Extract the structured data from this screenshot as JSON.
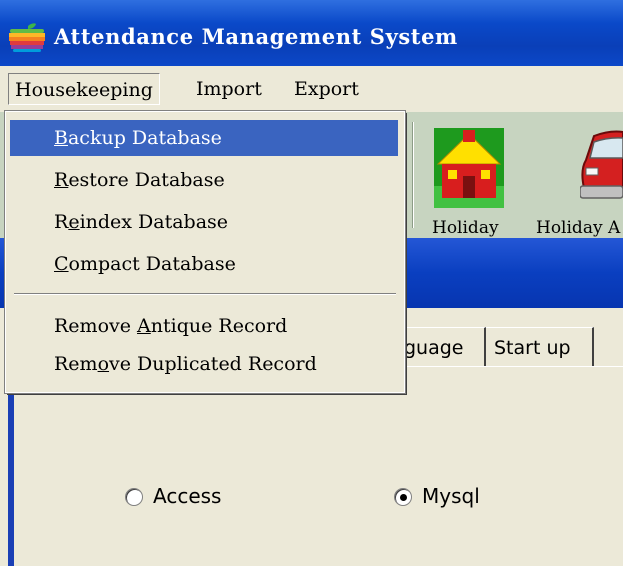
{
  "window": {
    "title": "Attendance Management System",
    "icon": "apple-logo-icon"
  },
  "menubar": {
    "items": [
      {
        "label": "Housekeeping",
        "active": true
      },
      {
        "label": "Import"
      },
      {
        "label": "Export"
      }
    ]
  },
  "housekeeping_menu": {
    "items": [
      {
        "mnemonic": "B",
        "rest": "ackup Database",
        "highlighted": true
      },
      {
        "mnemonic": "R",
        "rest": "estore Database"
      },
      {
        "pre": "R",
        "mnemonic": "e",
        "rest": "index Database"
      },
      {
        "mnemonic": "C",
        "rest": "ompact Database"
      },
      {
        "pre": "Remove ",
        "mnemonic": "A",
        "rest": "ntique Record"
      },
      {
        "pre": "Rem",
        "mnemonic": "o",
        "rest": "ve Duplicated Record"
      }
    ]
  },
  "toolbar": {
    "buttons": [
      {
        "label": "Holiday",
        "icon": "school-house-icon"
      },
      {
        "label": "Holiday A",
        "icon": "red-car-icon"
      }
    ]
  },
  "tabs": [
    {
      "label": "guage"
    },
    {
      "label": "Start up"
    }
  ],
  "database_options": [
    {
      "label": "Access",
      "selected": false
    },
    {
      "label": "Mysql",
      "selected": true
    }
  ],
  "colors": {
    "titlebar": "#0a49c9",
    "menu_highlight": "#3a64c0",
    "toolbar": "#c7d4c0",
    "panel": "#ece9d8"
  }
}
